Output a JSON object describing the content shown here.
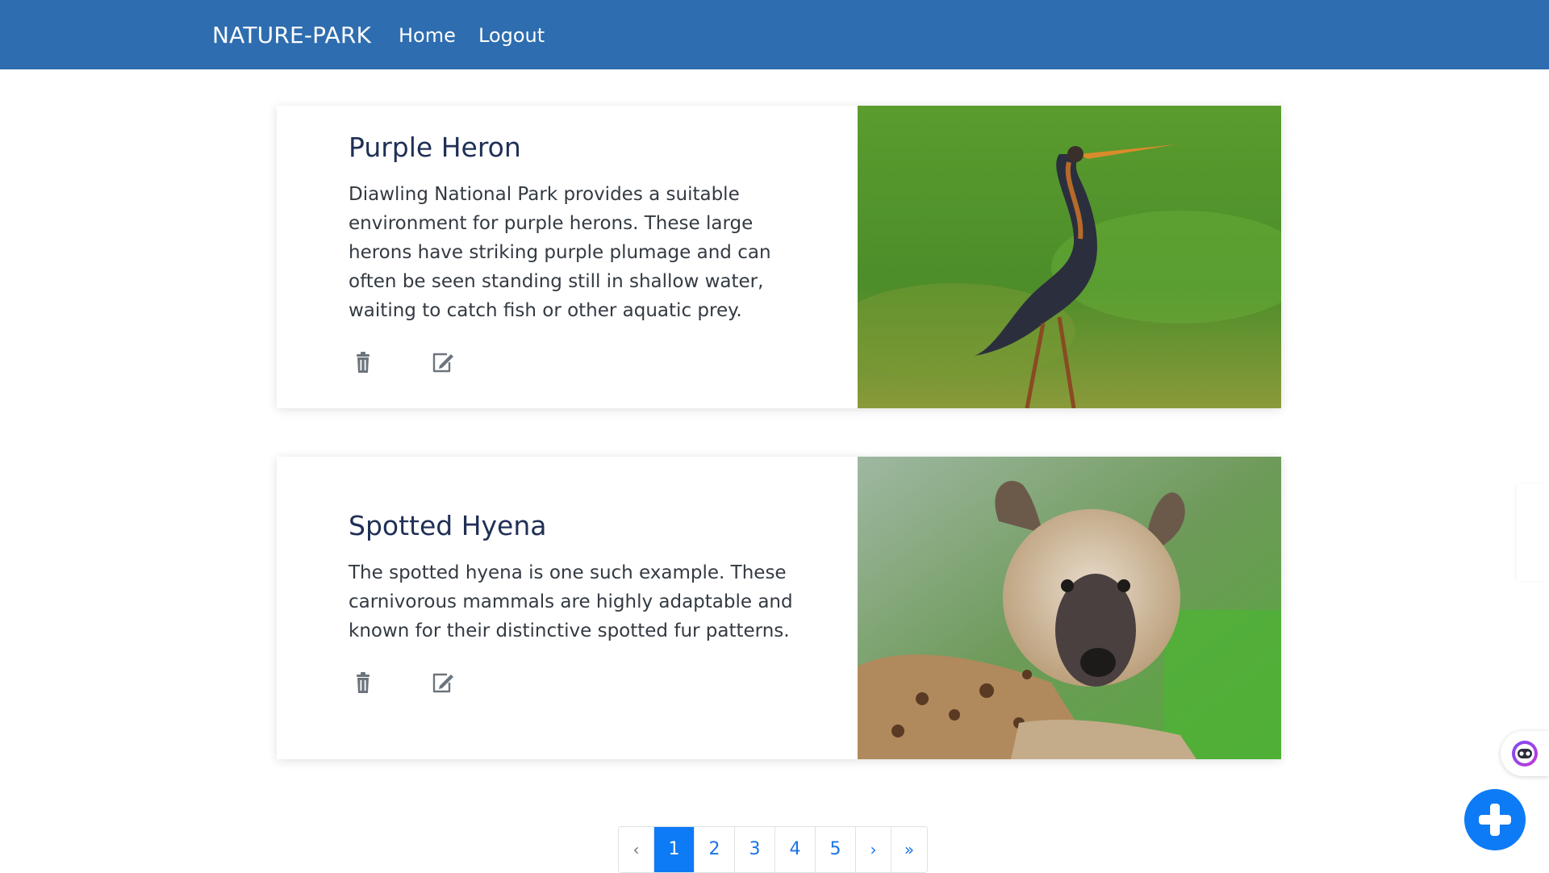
{
  "navbar": {
    "brand": "NATURE-PARK",
    "links": [
      "Home",
      "Logout"
    ],
    "background": "#2e6daf"
  },
  "cards": [
    {
      "title": "Purple Heron",
      "text": "Diawling National Park provides a suitable environment for purple herons. These large herons have striking purple plumage and can often be seen standing still in shallow water, waiting to catch fish or other aquatic prey.",
      "actions": [
        "trash-icon",
        "edit-icon"
      ],
      "image": "purple-heron-photo"
    },
    {
      "title": "Spotted Hyena",
      "text": "The spotted hyena is one such example. These carnivorous mammals are highly adaptable and known for their distinctive spotted fur patterns.",
      "actions": [
        "trash-icon",
        "edit-icon"
      ],
      "image": "spotted-hyena-photo"
    }
  ],
  "pagination": {
    "prev": "‹",
    "pages": [
      "1",
      "2",
      "3",
      "4",
      "5"
    ],
    "current": "1",
    "next": "›",
    "last": "»",
    "active_color": "#0d7bf5"
  },
  "fab": {
    "icon": "plus-icon",
    "color": "#0d7bf5"
  },
  "side_widget": {
    "icon": "assistant-face-icon"
  }
}
